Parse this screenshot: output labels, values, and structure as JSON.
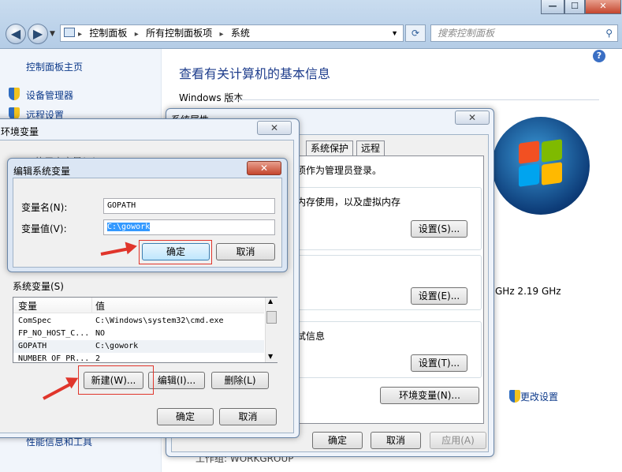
{
  "window_controls": [
    "—",
    "☐",
    "✕"
  ],
  "breadcrumb": [
    "控制面板",
    "所有控制面板项",
    "系统"
  ],
  "search": {
    "placeholder": "搜索控制面板"
  },
  "sidebar": {
    "home": "控制面板主页",
    "items": [
      {
        "label": "设备管理器"
      },
      {
        "label": "远程设置"
      }
    ],
    "bottom_link": "性能信息和工具"
  },
  "main": {
    "title": "查看有关计算机的基本信息",
    "section_windows": "Windows 版本",
    "cpu_speed": "GHz   2.19 GHz",
    "change_settings": "更改设置",
    "workgroup_row": "工作组:          WORKGROUP"
  },
  "system_properties": {
    "title": "系统属性",
    "tabs": [
      "系统保护",
      "远程"
    ],
    "admin_note": "须作为管理员登录。",
    "perf_text": "内存使用，以及虚拟内存",
    "debug_text": "试信息",
    "settings_s": "设置(S)...",
    "settings_e": "设置(E)...",
    "settings_t": "设置(T)...",
    "env_button": "环境变量(N)...",
    "ok": "确定",
    "cancel": "取消",
    "apply": "应用(A)"
  },
  "env_vars": {
    "title": "环境变量",
    "user_section_fragment": "的用户变量(U)",
    "system_section": "系统变量(S)",
    "columns": [
      "变量",
      "值"
    ],
    "rows": [
      {
        "name": "ComSpec",
        "value": "C:\\Windows\\system32\\cmd.exe"
      },
      {
        "name": "FP_NO_HOST_C...",
        "value": "NO"
      },
      {
        "name": "GOPATH",
        "value": "C:\\gowork"
      },
      {
        "name": "NUMBER_OF_PR...",
        "value": "2"
      }
    ],
    "new_button": "新建(W)...",
    "edit_button": "编辑(I)...",
    "delete_button": "删除(L)",
    "ok": "确定",
    "cancel": "取消"
  },
  "edit_dialog": {
    "title": "编辑系统变量",
    "name_label": "变量名(N):",
    "name_value": "GOPATH",
    "value_label": "变量值(V):",
    "value_value": "C:\\gowork",
    "ok": "确定",
    "cancel": "取消"
  },
  "colors": {
    "link": "#0d3a8a",
    "title_blue": "#1e3d8c",
    "annotation_red": "#e0352b",
    "selection": "#3399ff"
  }
}
